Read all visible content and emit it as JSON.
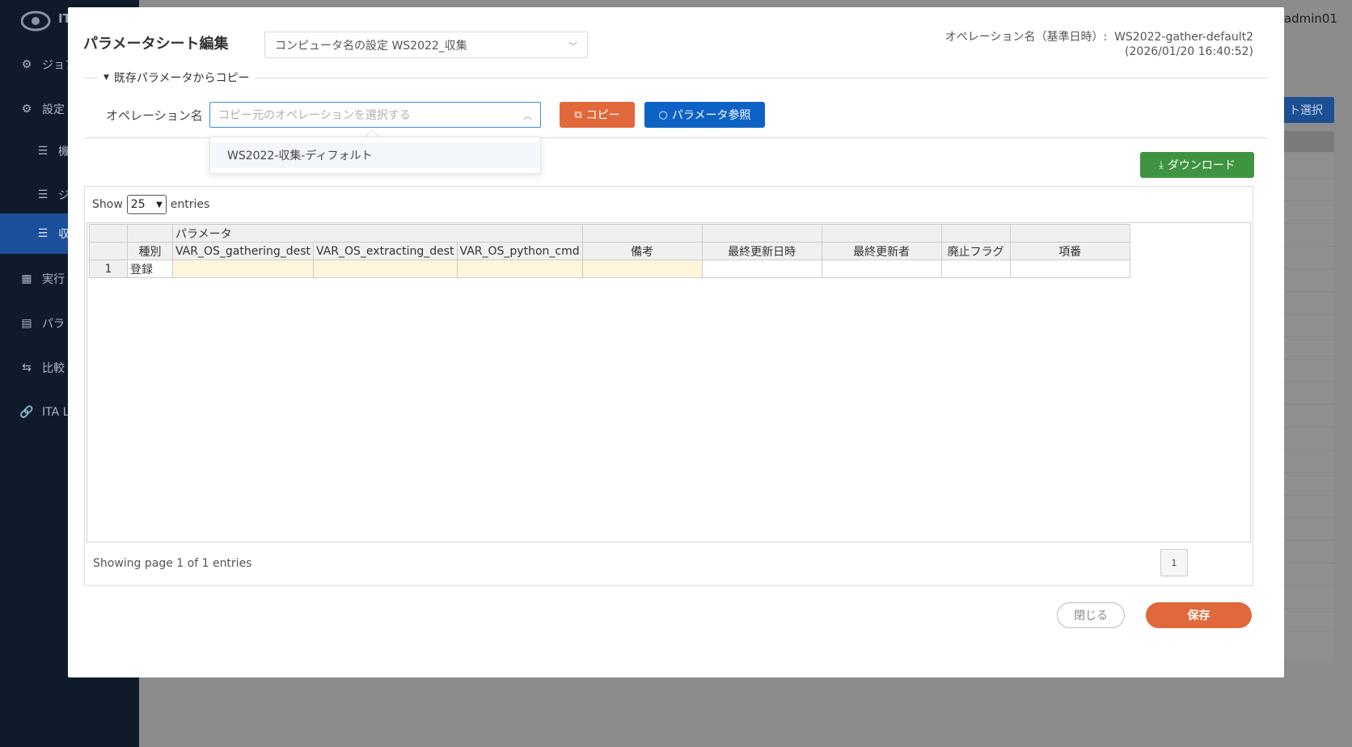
{
  "app": {
    "user": "admin01",
    "sidebar": [
      {
        "label": "ジョブ",
        "icon": "gear-icon"
      },
      {
        "label": "設定",
        "icon": "settings-icon"
      },
      {
        "label": "機",
        "icon": "sliders-icon"
      },
      {
        "label": "ジ",
        "icon": "sliders-icon"
      },
      {
        "label": "収",
        "icon": "sliders-icon"
      },
      {
        "label": "実行",
        "icon": "grid-icon"
      },
      {
        "label": "パラ",
        "icon": "document-icon"
      },
      {
        "label": "比較",
        "icon": "compare-icon"
      },
      {
        "label": "ITA L",
        "icon": "link-icon"
      }
    ],
    "bg_button": "ト選択"
  },
  "modal": {
    "title": "パラメータシート編集",
    "sheet_select_value": "コンピュータ名の設定 WS2022_収集",
    "operation_info_label": "オペレーション名（基準日時）:",
    "operation_info_name": "WS2022-gather-default2",
    "operation_info_date": "(2026/01/20 16:40:52)",
    "copy_section": {
      "toggle_label": "既存パラメータからコピー",
      "operation_label": "オペレーション名",
      "operation_placeholder": "コピー元のオペレーションを選択する",
      "copy_button": "コピー",
      "reference_button": "パラメータ参照",
      "dropdown_items": [
        "WS2022-収集-ディフォルト"
      ]
    },
    "download_button": "ダウンロード",
    "grid": {
      "show_label": "Show",
      "page_size": "25",
      "entries_label": "entries",
      "group_header": "パラメータ",
      "columns": [
        "種別",
        "VAR_OS_gathering_dest",
        "VAR_OS_extracting_dest",
        "VAR_OS_python_cmd",
        "備考",
        "最終更新日時",
        "最終更新者",
        "廃止フラグ",
        "項番"
      ],
      "rows": [
        {
          "num": "1",
          "type": "登録"
        }
      ],
      "footer": "Showing page 1 of 1 entries",
      "page": "1"
    },
    "close_button": "閉じる",
    "save_button": "保存"
  }
}
